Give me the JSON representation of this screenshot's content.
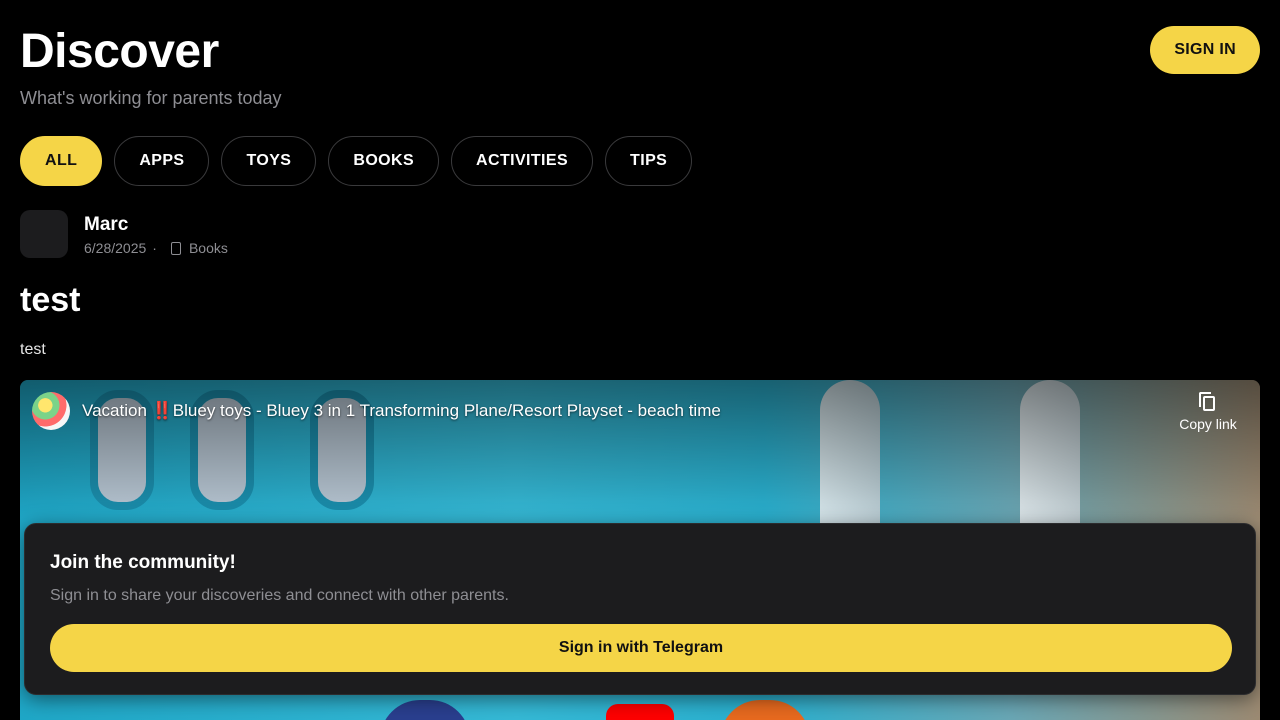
{
  "header": {
    "title": "Discover",
    "subtitle": "What's working for parents today",
    "sign_in_label": "SIGN IN"
  },
  "filters": [
    {
      "label": "ALL",
      "active": true
    },
    {
      "label": "APPS",
      "active": false
    },
    {
      "label": "TOYS",
      "active": false
    },
    {
      "label": "BOOKS",
      "active": false
    },
    {
      "label": "ACTIVITIES",
      "active": false
    },
    {
      "label": "TIPS",
      "active": false
    }
  ],
  "post": {
    "author": "Marc",
    "date": "6/28/2025",
    "separator": "·",
    "category_icon": "book-icon",
    "category": "Books",
    "title": "test",
    "body": "test"
  },
  "video": {
    "title_prefix": "Vacation ",
    "title_emphasis": "‼️",
    "title_rest": "Bluey toys - Bluey 3 in 1 Transforming Plane/Resort Playset - beach time",
    "copy_link_label": "Copy link",
    "copy_icon": "copy-icon"
  },
  "community": {
    "title": "Join the community!",
    "text": "Sign in to share your discoveries and connect with other parents.",
    "button_label": "Sign in with Telegram"
  },
  "colors": {
    "accent": "#f5d547",
    "background": "#000000",
    "card": "#1c1c1e",
    "muted_text": "#8e8e93"
  }
}
